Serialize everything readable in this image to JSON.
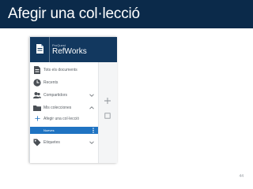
{
  "slide": {
    "title": "Afegir una col·lecció",
    "page_number": "44"
  },
  "app": {
    "brand_small": "ProQuest",
    "brand_name": "RefWorks"
  },
  "nav": {
    "items": [
      {
        "label": "Tots els documents",
        "icon": "document-icon"
      },
      {
        "label": "Recents",
        "icon": "clock-icon"
      },
      {
        "label": "Compartidors",
        "icon": "users-icon",
        "chevron": "down"
      },
      {
        "label": "Mis colecciones",
        "icon": "folder-icon",
        "chevron": "up"
      },
      {
        "label": "Afegir una col·lecció",
        "icon": "plus-icon"
      },
      {
        "label": "Nueves",
        "active": true
      },
      {
        "label": "Etiquetes",
        "icon": "tag-icon",
        "chevron": "down"
      }
    ]
  },
  "colors": {
    "title_bar": "#0b2a4a",
    "brand_bar": "#12385f",
    "active_row": "#1f73c2"
  }
}
